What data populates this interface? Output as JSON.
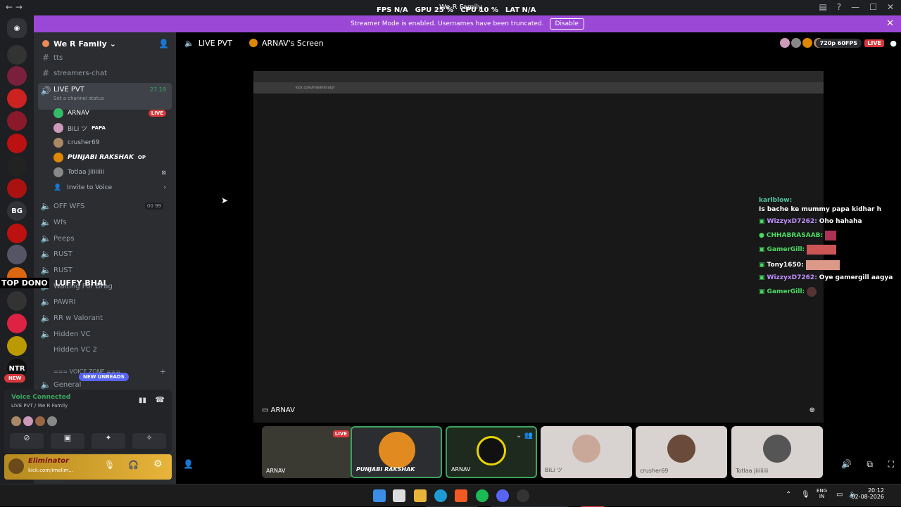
{
  "titlebar": {
    "title": "We R Family",
    "nav": "←  →"
  },
  "stats": {
    "fps_label": "FPS",
    "fps": "N/A",
    "gpu_label": "GPU",
    "gpu": "25 %",
    "cpu_label": "CPU",
    "cpu": "10 %",
    "lat_label": "LAT",
    "lat": "N/A"
  },
  "banner": {
    "text": "Streamer Mode is enabled. Usernames have been truncated.",
    "button": "Disable"
  },
  "rail": {
    "bg_label": "BG",
    "new_badge": "NEW",
    "top_dono": "TOP DONO"
  },
  "server": {
    "name": "We R Family"
  },
  "channels": [
    {
      "name": "tts"
    },
    {
      "name": "streamers-chat"
    },
    {
      "name": "LIVE PVT",
      "time": "27:19",
      "status": "Set a channel status"
    },
    {
      "name": "OFF WFS",
      "count1": "00",
      "count2": "99"
    },
    {
      "name": "Wfs"
    },
    {
      "name": "Peeps"
    },
    {
      "name": "RUST"
    },
    {
      "name": "RUST"
    },
    {
      "name": "Waiting For Drag"
    },
    {
      "name": "PAWRI"
    },
    {
      "name": "RR w Valorant"
    },
    {
      "name": "Hidden VC"
    },
    {
      "name": "Hidden VC 2"
    },
    {
      "name": "=== VOICE ZONE ==="
    },
    {
      "name": "General"
    }
  ],
  "voice_users": [
    {
      "name": "ARNAV",
      "badge": "LIVE"
    },
    {
      "name": "BiLi ツ",
      "tag": "PAPA"
    },
    {
      "name": "crusher69"
    },
    {
      "name": "PUNJABI RAKSHAK",
      "tag": "OP"
    },
    {
      "name": "Totlaa Jiiiiiiii"
    }
  ],
  "invite": "Invite to Voice",
  "overlay_name": "LUFFY BHAI",
  "new_unreads": "NEW UNREADS",
  "voice": {
    "title": "Voice Connected",
    "subtitle": "LIVE PVT / We R Family"
  },
  "userbar": {
    "name": "Eliminator",
    "status": "kick.com/imelim..."
  },
  "stage": {
    "channel": "LIVE PVT",
    "screen_title": "ARNAV's Screen",
    "quality": "720p 60FPS",
    "live": "LIVE",
    "presenter": "ARNAV",
    "url": "kick.com/imeliminator"
  },
  "tiles": [
    {
      "name": "ARNAV",
      "live": "LIVE"
    },
    {
      "name": "PUNJABI RAKSHAK"
    },
    {
      "name": "ARNAV"
    },
    {
      "name": "BiLi ツ"
    },
    {
      "name": "crusher69"
    },
    {
      "name": "Totlaa Jiiiiiiii"
    }
  ],
  "chat": [
    {
      "user": "karlblow:",
      "msg": "Is bache ke mummy papa kidhar h",
      "color": "#4fc3a1"
    },
    {
      "user": "WizzyxD7262:",
      "msg": "Oho hahaha",
      "color": "#c18fff"
    },
    {
      "user": "CHHABRASAAB:",
      "msg": "",
      "color": "#4cd964"
    },
    {
      "user": "GamerGill:",
      "msg": "",
      "color": "#4cd964"
    },
    {
      "user": "Tony1650:",
      "msg": "",
      "color": "#ffffff"
    },
    {
      "user": "WizzyxD7262:",
      "msg": "Oye gamergill aagya",
      "color": "#c18fff"
    },
    {
      "user": "GamerGill:",
      "msg": "",
      "color": "#4cd964"
    }
  ],
  "taskbar": {
    "lang1": "ENG",
    "lang2": "IN",
    "time": "20:12",
    "date": "02-08-2026"
  }
}
